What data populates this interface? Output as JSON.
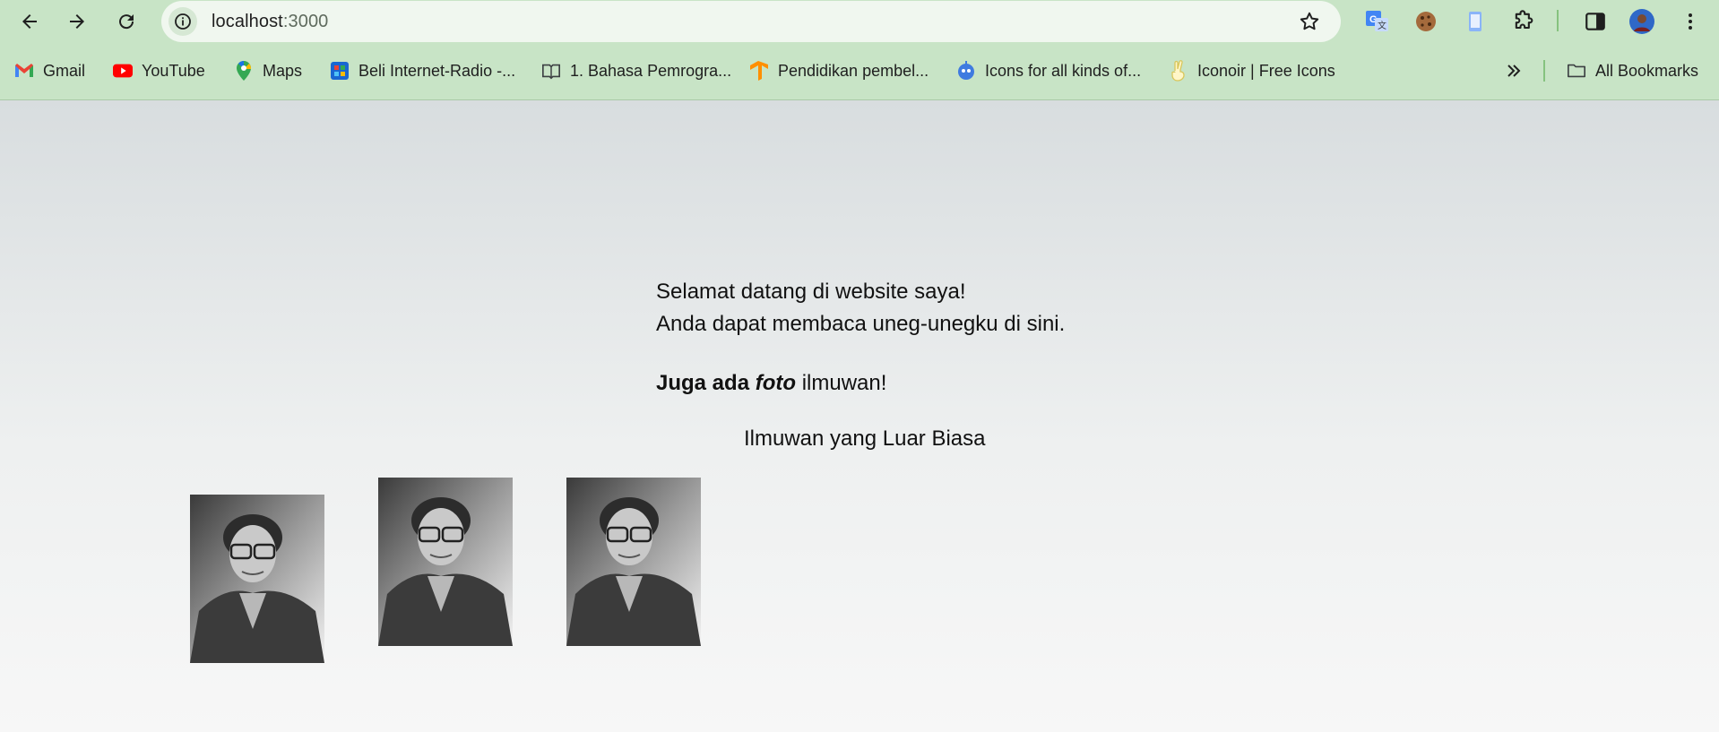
{
  "browser": {
    "url_host": "localhost",
    "url_port": ":3000",
    "bookmarks": [
      {
        "label": "Gmail",
        "icon": "gmail-icon"
      },
      {
        "label": "YouTube",
        "icon": "youtube-icon"
      },
      {
        "label": "Maps",
        "icon": "maps-icon"
      },
      {
        "label": "Beli Internet-Radio -...",
        "icon": "store-icon"
      },
      {
        "label": "1. Bahasa Pemrogra...",
        "icon": "book-icon"
      },
      {
        "label": "Pendidikan pembel...",
        "icon": "tensorflow-icon"
      },
      {
        "label": "Icons for all kinds of...",
        "icon": "robot-icon"
      },
      {
        "label": "Iconoir | Free Icons",
        "icon": "peace-hand-icon"
      }
    ],
    "all_bookmarks_label": "All Bookmarks",
    "extensions": [
      "translate-icon",
      "cookie-icon",
      "device-icon",
      "puzzle-icon",
      "sidepanel-icon",
      "avatar",
      "kebab-menu-icon"
    ],
    "colors": {
      "chrome": "#c8e4c6",
      "omnibox": "#f0f7ef",
      "accent": "#86c27f"
    }
  },
  "content": {
    "intro_line1": "Selamat datang di website saya!",
    "intro_line2": "Anda dapat membaca uneg-unegku di sini.",
    "highlight_bold": "Juga ada",
    "highlight_bold_italic": "foto",
    "highlight_rest": "ilmuwan!",
    "caption": "Ilmuwan yang Luar Biasa",
    "photos_count": 3
  }
}
